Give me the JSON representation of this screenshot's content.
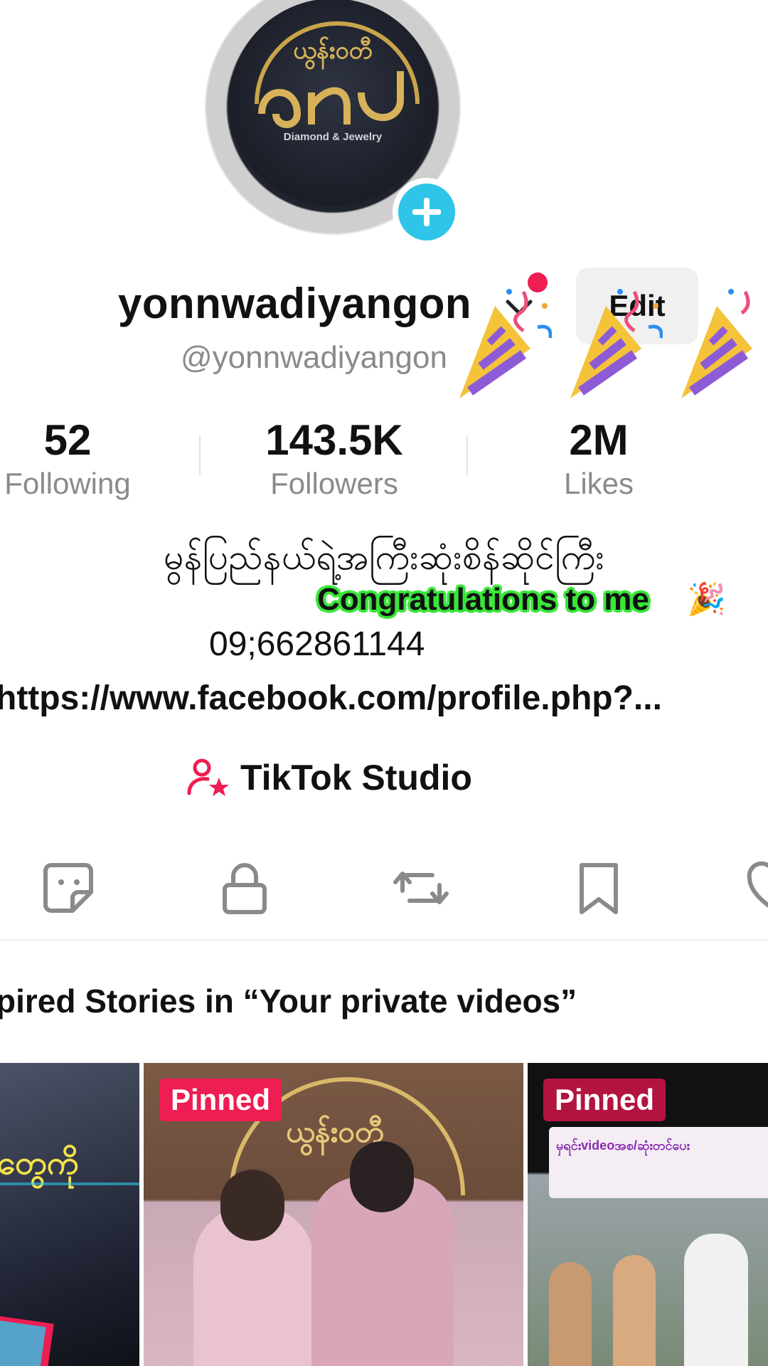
{
  "profile": {
    "avatar_logo_top": "ယွန်းဝတီ",
    "avatar_logo": "ꩻꩻ",
    "avatar_tagline": "Diamond & Jewelry",
    "username": "yonnwadiyangon",
    "handle": "@yonnwadiyangon",
    "edit_label": "Edit"
  },
  "stats": [
    {
      "value": "52",
      "label": "Following"
    },
    {
      "value": "143.5K",
      "label": "Followers"
    },
    {
      "value": "2M",
      "label": "Likes"
    }
  ],
  "bio": {
    "line1": "မွန်ပြည်နယ်ရဲ့အကြီးဆုံးစိန်ဆိုင်ကြီး",
    "congrats": "Congratulations to me",
    "congrats_emoji": "🎉",
    "phone": "09;662861144",
    "link": "https://www.facebook.com/profile.php?..."
  },
  "studio": {
    "label": "TikTok Studio"
  },
  "tabs": [
    "stickers-icon",
    "lock-icon",
    "repost-icon",
    "bookmark-icon",
    "liked-icon"
  ],
  "stories_text": "pired Stories in “Your private videos”",
  "grid": [
    {
      "badge": "",
      "caption": "တွေကို"
    },
    {
      "badge": "Pinned",
      "caption": "ယွန်းဝတီ"
    },
    {
      "badge": "Pinned",
      "caption": "မှရင်းvideoအစ/ဆုံးတင်ပေး"
    }
  ],
  "colors": {
    "accent": "#ee1d52",
    "add_button": "#2ec5e8",
    "congrats_outline": "#39e639"
  }
}
